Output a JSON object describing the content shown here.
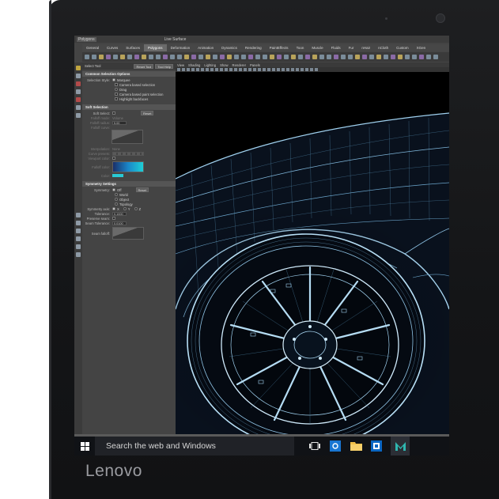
{
  "brand": {
    "logo_text": "Lenovo"
  },
  "maya": {
    "menubar": [
      "Polygons",
      "Live Surface"
    ],
    "shelf_tabs": [
      "General",
      "Curves",
      "Surfaces",
      "Polygons",
      "Deformation",
      "Animation",
      "Dynamics",
      "Rendering",
      "PaintEffects",
      "Toon",
      "Muscle",
      "Fluids",
      "Fur",
      "nHair",
      "nCloth",
      "Custom",
      "XGen"
    ],
    "active_shelf_tab": "Polygons",
    "tool_settings": {
      "header_title": "Tool Settings",
      "tool_name": "Select Tool",
      "reset_label": "Reset Tool",
      "help_label": "Tool Help",
      "common_section": "Common Selection Options",
      "selection_style_label": "Selection Style:",
      "selection_style_option": "Marquee",
      "camera_based_selection": "Camera based selection",
      "drag_label": "Drag",
      "camera_based_paint": "Camera based paint selection",
      "highlight_backfaces": "Highlight backfaces",
      "soft_section": "Soft Selection",
      "soft_select_label": "Soft Select:",
      "reset_btn": "Reset",
      "falloff_mode_label": "Falloff mode:",
      "falloff_mode_value": "Volume",
      "falloff_radius_label": "Falloff radius:",
      "falloff_radius_value": "5.00",
      "falloff_curve_label": "Falloff curve:",
      "interpolation_label": "Interpolation:",
      "interpolation_value": "None",
      "curve_presets_label": "Curve presets:",
      "viewport_color_label": "Viewport color:",
      "falloff_color_label": "Falloff color:",
      "color_label": "Color:",
      "symmetry_section": "Symmetry Settings",
      "symmetry_label": "Symmetry:",
      "symmetry_options": [
        "Off",
        "World",
        "Object",
        "Topology"
      ],
      "symmetry_reset": "Reset",
      "symmetry_axis_label": "Symmetry axis:",
      "symmetry_axes": [
        "X",
        "Y",
        "Z"
      ],
      "tolerance_label": "Tolerance:",
      "tolerance_value": "0.1000",
      "preserve_seam_label": "Preserve seam:",
      "seam_tolerance_label": "Seam Tolerance:",
      "seam_tolerance_value": "0.0100",
      "seam_falloff_label": "Seam falloff:"
    },
    "viewport_menu": [
      "View",
      "Shading",
      "Lighting",
      "Show",
      "Renderer",
      "Panels"
    ]
  },
  "taskbar": {
    "search_placeholder": "Search the web and Windows",
    "icons": [
      "task-view-icon",
      "edge-icon",
      "file-explorer-icon",
      "outlook-icon",
      "maya-icon"
    ]
  },
  "colors": {
    "bezel": "#151618",
    "taskbar": "#101216",
    "wireframe": "#8fc4e6",
    "maya_panel": "#444444"
  }
}
